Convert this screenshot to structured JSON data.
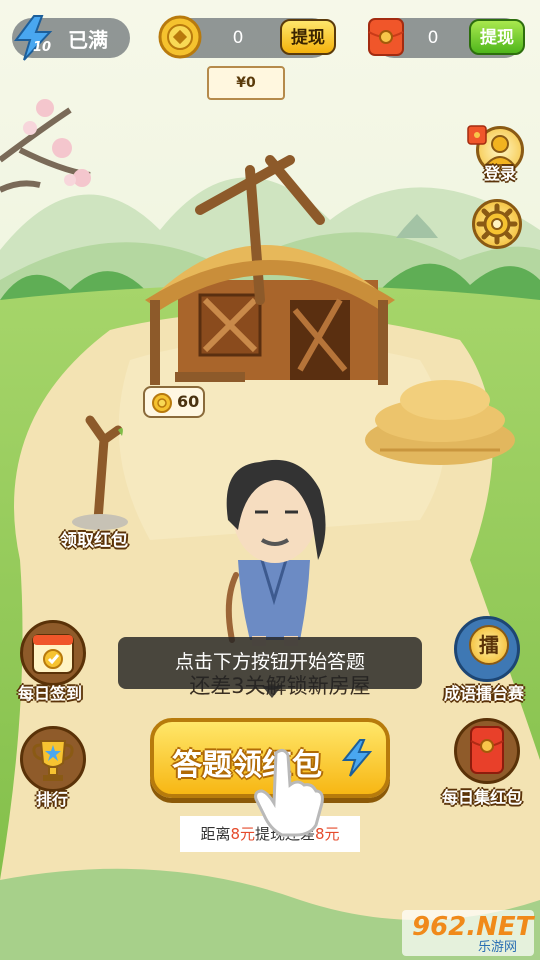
{
  "topbar": {
    "energy_level": "10",
    "energy_status": "已满",
    "coin_value": "0",
    "coin_withdraw": "提现",
    "redpacket_value": "0",
    "redpacket_withdraw": "提现",
    "money_tag": "¥0"
  },
  "right_menu": {
    "login": "登录",
    "settings_icon": "gear-icon"
  },
  "scene": {
    "house_coin_reward": "60",
    "tree_label": "领取红包"
  },
  "side_buttons": {
    "daily_checkin": "每日签到",
    "ranking": "排行",
    "idiom_arena": "成语擂台赛",
    "arena_badge": "擂",
    "daily_redpacket": "每日集红包"
  },
  "tip": "点击下方按钮开始答题",
  "unlock_hint": "还差3关解锁新房屋",
  "main_button": "答题领红包",
  "distance": {
    "prefix": "距离",
    "amount1": "8元",
    "middle": "提现还差",
    "amount2": "8元"
  },
  "watermark": {
    "brand": "962.NET",
    "sub": "乐游网"
  },
  "colors": {
    "accent_yellow": "#f7b714",
    "accent_green": "#4fb61c",
    "red": "#e54b2c"
  }
}
